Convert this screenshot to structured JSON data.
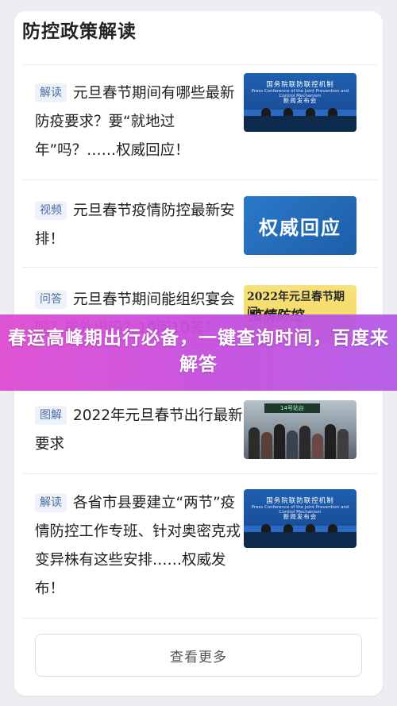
{
  "section": {
    "title": "防控政策解读"
  },
  "items": [
    {
      "tag": "解读",
      "text": "元旦春节期间有哪些最新防疫要求？要“就地过年”吗？……权威回应！",
      "thumb": {
        "kind": "conference",
        "line1": "国务院联防联控机制",
        "line2": "Press Conference of the Joint Prevention and Control Mechanism",
        "line3": "新闻发布会"
      }
    },
    {
      "tag": "视频",
      "text": "元旦春节疫情防控最新安排！",
      "thumb": {
        "kind": "authority",
        "label": "权威回应"
      }
    },
    {
      "tag": "问答",
      "text": "元旦春节期间能组织宴会吗？能外出吗？10问10答！",
      "thumb": {
        "kind": "poster",
        "line1": "2022年元旦春节期间,",
        "line2": "疫情防控"
      }
    },
    {
      "tag": "图解",
      "text": "2022年元旦春节出行最新要求",
      "thumb": {
        "kind": "station",
        "sign": "14号站台"
      }
    },
    {
      "tag": "解读",
      "text": "各省市县要建立“两节”疫情防控工作专班、针对奥密克戎变异株有这些安排……权威发布！",
      "thumb": {
        "kind": "conference",
        "line1": "国务院联防联控机制",
        "line2": "Press Conference of the Joint Prevention and Control Mechanism",
        "line3": "新闻发布会"
      }
    }
  ],
  "more_button": {
    "label": "查看更多"
  },
  "banner": {
    "text": "春运高峰期出行必备，一键查询时间，百度来解答"
  },
  "colors": {
    "tag_bg": "#eef3fb",
    "tag_text": "#4a6c9e",
    "banner": "#d64fd6",
    "thumb_blue": "#1f5fb0"
  }
}
